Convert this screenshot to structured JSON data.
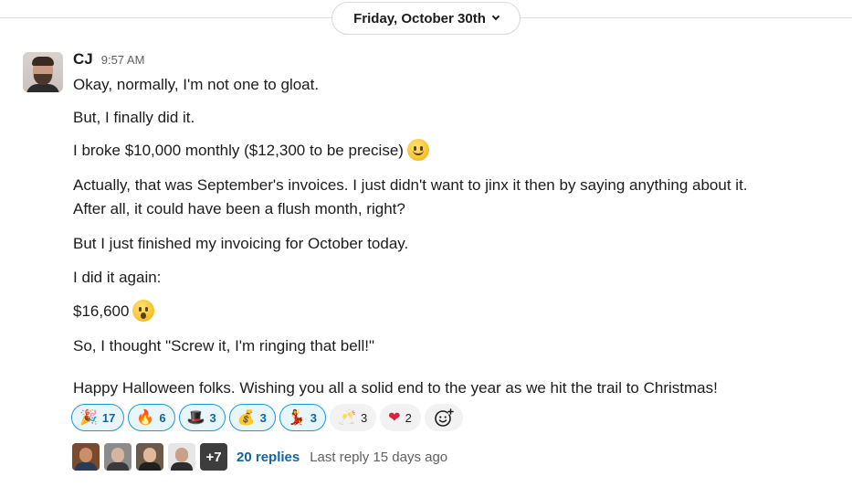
{
  "date_divider": {
    "label": "Friday, October 30th"
  },
  "message": {
    "author": "CJ",
    "time": "9:57 AM",
    "lines": [
      "Okay, normally, I'm not one to gloat.",
      "But, I finally did it.",
      "I broke $10,000 monthly ($12,300 to be precise)",
      "Actually, that was September's invoices. I just didn't want to jinx it then by saying anything about it.",
      "After all, it could have been a flush month, right?",
      "But I just finished my invoicing for October today.",
      "I did it again:",
      "$16,600",
      "So, I thought \"Screw it, I'm ringing that bell!\"",
      "Happy Halloween folks. Wishing you all a solid end to the year as we hit the trail to Christmas!"
    ]
  },
  "reactions": [
    {
      "emoji": "🎉",
      "name": "tada-icon",
      "count": "17",
      "mine": true
    },
    {
      "emoji": "🔥",
      "name": "fire-icon",
      "count": "6",
      "mine": true
    },
    {
      "emoji": "🎩",
      "name": "top-hat-icon",
      "count": "3",
      "mine": true
    },
    {
      "emoji": "💰",
      "name": "money-bag-icon",
      "count": "3",
      "mine": true
    },
    {
      "emoji": "💃",
      "name": "dancer-icon",
      "count": "3",
      "mine": true
    },
    {
      "emoji": "🥂",
      "name": "clinking-glasses-icon",
      "count": "3",
      "mine": false
    },
    {
      "emoji": "❤",
      "name": "heart-icon",
      "count": "2",
      "mine": false
    }
  ],
  "thread": {
    "more_participants": "+7",
    "replies_label": "20 replies",
    "last_reply": "Last reply 15 days ago"
  },
  "colors": {
    "link": "#1264a3",
    "reaction_active_bg": "#e8f5fa",
    "reaction_active_border": "#1d9bd1",
    "muted_text": "#616061"
  }
}
